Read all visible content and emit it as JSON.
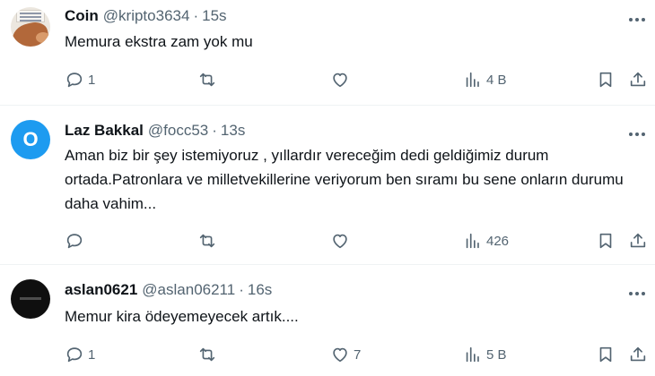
{
  "tweets": [
    {
      "name": "Coin",
      "handle": "@kripto3634",
      "separator": "·",
      "time": "15s",
      "text": "Memura ekstra zam yok mu",
      "replies": "1",
      "retweets": "",
      "likes": "",
      "views": "4 B",
      "avatar": "horse-photo"
    },
    {
      "name": "Laz Bakkal",
      "handle": "@focc53",
      "separator": "·",
      "time": "13s",
      "text": "Aman biz bir şey istemiyoruz , yıllardır vereceğim dedi geldiğimiz durum ortada.Patronlara ve milletvekillerine veriyorum ben sıramı bu sene onların durumu daha vahim...",
      "avatar_letter": "O",
      "replies": "",
      "retweets": "",
      "likes": "",
      "views": "426",
      "avatar_color": "#1d9bf0"
    },
    {
      "name": "aslan0621",
      "handle": "@aslan06211",
      "separator": "·",
      "time": "16s",
      "text": "Memur kira ödeyemeyecek artık....",
      "replies": "1",
      "retweets": "",
      "likes": "7",
      "views": "5 B",
      "avatar": "dark-logo"
    }
  ],
  "icons": {
    "reply": "reply-bubble-icon",
    "retweet": "retweet-icon",
    "like": "heart-icon",
    "views": "bar-chart-icon",
    "bookmark": "bookmark-icon",
    "share": "share-upload-icon",
    "more": "more-dots-icon"
  },
  "colors": {
    "text": "#0f1419",
    "secondary": "#536471",
    "divider": "#eff3f4",
    "accent": "#1d9bf0"
  }
}
